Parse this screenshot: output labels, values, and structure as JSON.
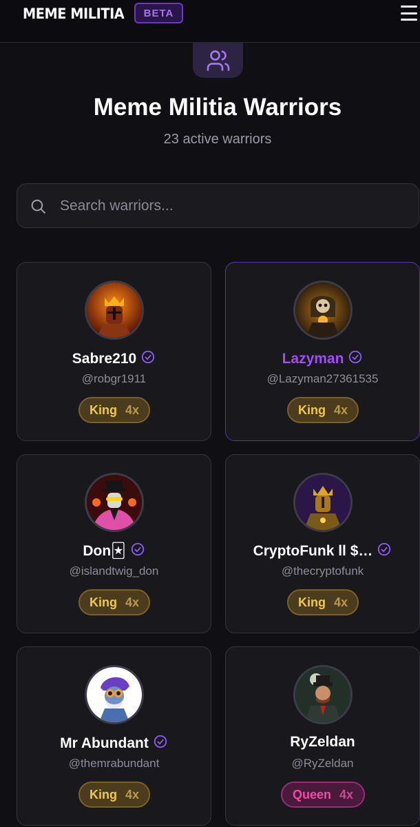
{
  "header": {
    "brand": "MEME MILITIA",
    "beta_label": "BETA"
  },
  "hero": {
    "title": "Meme Militia Warriors",
    "subtitle": "23 active warriors"
  },
  "search": {
    "placeholder": "Search warriors..."
  },
  "warriors": [
    {
      "name": "Sabre210",
      "handle": "@robgr1911",
      "rank": "King",
      "multiplier": "4x",
      "verified": true
    },
    {
      "name": "Lazyman",
      "handle": "@Lazyman27361535",
      "rank": "King",
      "multiplier": "4x",
      "verified": true
    },
    {
      "name": "Don🃏",
      "handle": "@islandtwig_don",
      "rank": "King",
      "multiplier": "4x",
      "verified": true
    },
    {
      "name": "CryptoFunk ll $…",
      "handle": "@thecryptofunk",
      "rank": "King",
      "multiplier": "4x",
      "verified": true
    },
    {
      "name": "Mr Abundant",
      "handle": "@themrabundant",
      "rank": "King",
      "multiplier": "4x",
      "verified": true
    },
    {
      "name": "RyZeldan",
      "handle": "@RyZeldan",
      "rank": "Queen",
      "multiplier": "4x",
      "verified": false
    }
  ],
  "colors": {
    "accent": "#a14cf5",
    "king": "#f2c84b",
    "queen": "#f24aa6",
    "background": "#101014"
  }
}
